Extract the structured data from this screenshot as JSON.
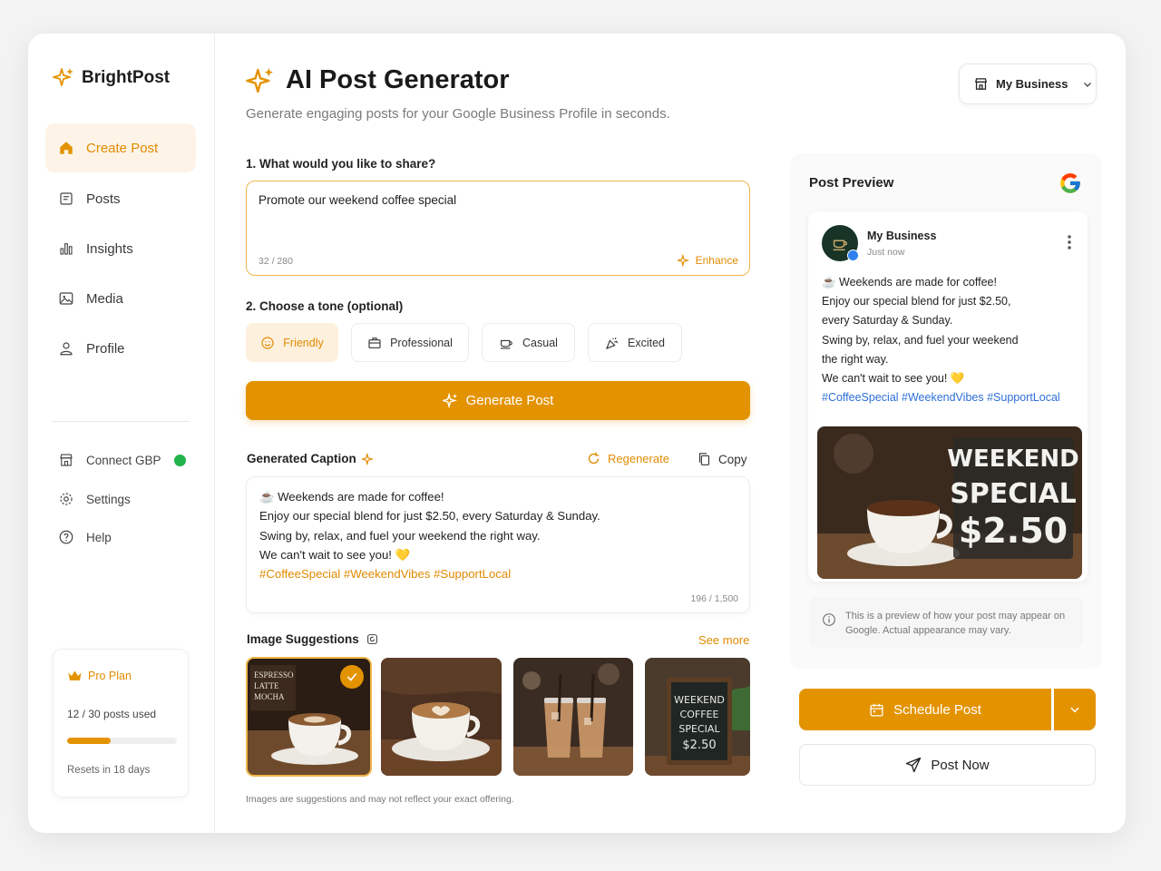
{
  "brand": {
    "name": "BrightPost",
    "accent": "#E49300"
  },
  "sidebar": {
    "items": [
      {
        "label": "Create Post",
        "icon": "home-icon",
        "active": true
      },
      {
        "label": "Posts",
        "icon": "posts-icon"
      },
      {
        "label": "Insights",
        "icon": "bar-chart-icon"
      },
      {
        "label": "Media",
        "icon": "image-icon"
      },
      {
        "label": "Profile",
        "icon": "user-icon"
      }
    ],
    "secondary": [
      {
        "label": "Connect GBP",
        "icon": "store-icon",
        "status": "connected",
        "status_color": "#22B24C"
      },
      {
        "label": "Settings",
        "icon": "gear-icon"
      },
      {
        "label": "Help",
        "icon": "help-icon"
      }
    ],
    "plan": {
      "name": "Pro Plan",
      "usage": "12 / 30 posts used",
      "used": 12,
      "limit": 30,
      "resets": "Resets in 18 days"
    }
  },
  "header": {
    "title": "AI Post Generator",
    "subtitle": "Generate engaging posts for your Google Business Profile in seconds.",
    "business_select": "My Business"
  },
  "form": {
    "share_label": "1. What would you like to share?",
    "share_value": "Promote our weekend coffee special",
    "share_count": "32 / 280",
    "enhance_label": "Enhance",
    "tone_label": "2. Choose a tone (optional)",
    "tones": [
      {
        "label": "Friendly",
        "icon": "smile-icon",
        "selected": true
      },
      {
        "label": "Professional",
        "icon": "briefcase-icon"
      },
      {
        "label": "Casual",
        "icon": "coffee-cup-icon"
      },
      {
        "label": "Excited",
        "icon": "party-popper-icon"
      }
    ],
    "generate_label": "Generate Post"
  },
  "caption": {
    "title": "Generated Caption",
    "regenerate_label": "Regenerate",
    "copy_label": "Copy",
    "lines": [
      "☕ Weekends are made for coffee!",
      "Enjoy our special blend for just $2.50, every Saturday & Sunday.",
      "Swing by, relax, and fuel your weekend the right way.",
      "We can't wait to see you! 💛"
    ],
    "hashtags": "#CoffeeSpecial #WeekendVibes #SupportLocal",
    "count": "196 / 1,500"
  },
  "images": {
    "title": "Image Suggestions",
    "see_more": "See more",
    "note": "Images are suggestions and may not reflect your exact offering.",
    "thumb4_text": [
      "WEEKEND",
      "COFFEE",
      "SPECIAL",
      "$2.50"
    ]
  },
  "preview": {
    "title": "Post Preview",
    "business": "My Business",
    "time": "Just now",
    "lines": [
      "☕ Weekends are made for coffee!",
      "Enjoy our special blend for just $2.50,",
      "every Saturday & Sunday.",
      "Swing by, relax, and fuel your weekend",
      "the right way.",
      "We can't wait to see you! 💛"
    ],
    "hashtags": "#CoffeeSpecial #WeekendVibes #SupportLocal",
    "image_text": [
      "WEEKEND",
      "SPECIAL",
      "$2.50"
    ],
    "note": "This is a preview of how your post may appear on Google. Actual appearance may vary."
  },
  "actions": {
    "schedule_label": "Schedule Post",
    "post_now_label": "Post Now"
  }
}
